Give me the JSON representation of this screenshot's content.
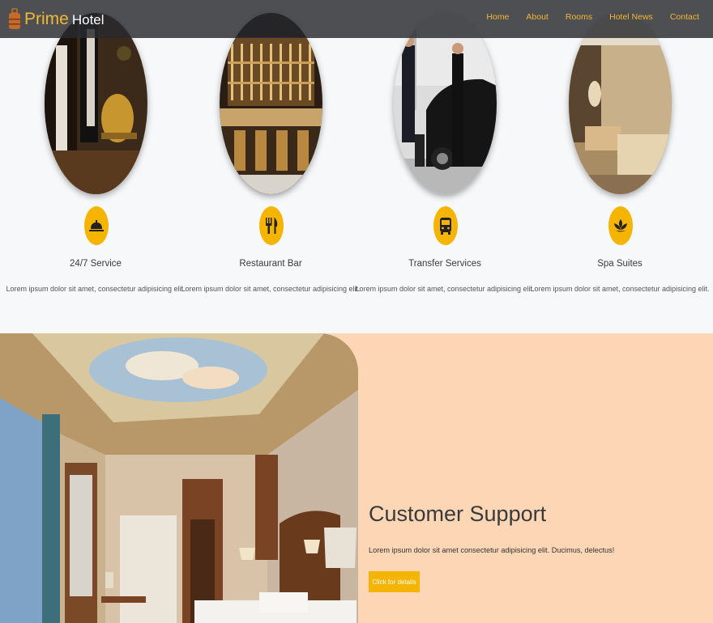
{
  "brand": {
    "name_main": "Prime",
    "name_sub": "Hotel",
    "icon": "suitcase-icon"
  },
  "nav": {
    "items": [
      {
        "label": "Home"
      },
      {
        "label": "About"
      },
      {
        "label": "Rooms"
      },
      {
        "label": "Hotel News"
      },
      {
        "label": "Contact"
      }
    ]
  },
  "services": [
    {
      "title": "24/7 Service",
      "desc": "Lorem ipsum dolor sit amet, consectetur adipisicing elit.",
      "icon": "service-bell-icon"
    },
    {
      "title": "Restaurant Bar",
      "desc": "Lorem ipsum dolor sit amet, consectetur adipisicing elit.",
      "icon": "fork-knife-icon"
    },
    {
      "title": "Transfer Services",
      "desc": "Lorem ipsum dolor sit amet, consectetur adipisicing elit.",
      "icon": "bus-icon"
    },
    {
      "title": "Spa Suites",
      "desc": "Lorem ipsum dolor sit amet, consectetur adipisicing elit.",
      "icon": "lotus-icon"
    }
  ],
  "support": {
    "title": "Customer Support",
    "text": "Lorem ipsum dolor sit amet consectetur adipisicing elit. Ducimus, delectus!",
    "button": "Click for details"
  },
  "colors": {
    "accent": "#f5b400",
    "nav_bg": "#282a2e",
    "support_bg": "#fdd6b5",
    "page_bg": "#f7f8fa"
  }
}
